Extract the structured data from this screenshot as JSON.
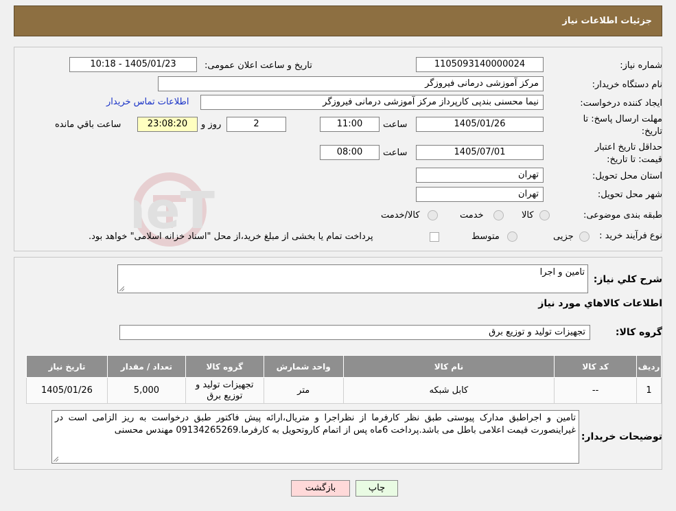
{
  "header": {
    "title": "جزئیات اطلاعات نیاز"
  },
  "watermark": {
    "text": "AriaTender.neT"
  },
  "form": {
    "need_number": {
      "label": "شماره نیاز:",
      "value": "1105093140000024"
    },
    "announce_datetime": {
      "label": "تاریخ و ساعت اعلان عمومی:",
      "value": "1405/01/23 - 10:18"
    },
    "buyer_org": {
      "label": "نام دستگاه خریدار:",
      "value": "مرکز آموزشی درمانی فیروزگر"
    },
    "requester": {
      "label": "ایجاد کننده درخواست:",
      "value": "نیما محسنی بندپی کارپرداز مرکز آموزشی درمانی فیروزگر",
      "contact_link": "اطلاعات تماس خریدار"
    },
    "reply_deadline": {
      "label": "مهلت ارسال پاسخ: تا تاریخ:",
      "date": "1405/01/26",
      "time_label": "ساعت",
      "time": "11:00",
      "days": "2",
      "days_label": "روز و",
      "remaining": "23:08:20",
      "remaining_label": "ساعت باقي مانده"
    },
    "price_validity": {
      "label": "حداقل تاریخ اعتبار قیمت: تا تاریخ:",
      "date": "1405/07/01",
      "time_label": "ساعت",
      "time": "08:00"
    },
    "delivery_province": {
      "label": "استان محل تحویل:",
      "value": "تهران"
    },
    "delivery_city": {
      "label": "شهر محل تحویل:",
      "value": "تهران"
    },
    "category": {
      "label": "طبقه بندی موضوعی:",
      "options": [
        "کالا",
        "خدمت",
        "کالا/خدمت"
      ]
    },
    "purchase_type": {
      "label": "نوع فرآیند خرید :",
      "options": [
        "جزیی",
        "متوسط"
      ],
      "note": "پرداخت تمام یا بخشی از مبلغ خرید،از محل \"اسناد خزانه اسلامی\" خواهد بود."
    }
  },
  "details": {
    "summary_label": "شرح کلي نياز:",
    "summary_value": "تامین و اجرا",
    "goods_title": "اطلاعات کالاهاي مورد نياز",
    "group_label": "گروه کالا:",
    "group_value": "تجهیزات تولید و توزیع برق",
    "table": {
      "headers": [
        "رديف",
        "کد کالا",
        "نام کالا",
        "واحد شمارش",
        "گروه کالا",
        "تعداد / مقدار",
        "تاریخ نیاز"
      ],
      "rows": [
        [
          "1",
          "--",
          "کابل شبکه",
          "متر",
          "تجهیزات تولید و توزیع برق",
          "5,000",
          "1405/01/26"
        ]
      ]
    },
    "buyer_notes_label": "توضیحات خریدار:",
    "buyer_notes_value": "تامین و اجراطبق مدارک پیوستی طبق نظر کارفرما از نظراجرا و متریال،ارائه پیش فاکتور طبق درخواست به ریز الزامی است در غیراینصورت قیمت اعلامی باطل می باشد.پرداخت 6ماه پس از اتمام کاروتحویل به کارفرما.09134265269 مهندس محسنی"
  },
  "buttons": {
    "print": "چاپ",
    "back": "بازگشت"
  },
  "colors": {
    "header": "#8d6f41",
    "back_button": "#ffd9d9",
    "print_button": "#e9fbe3",
    "link": "#1a33c7"
  }
}
